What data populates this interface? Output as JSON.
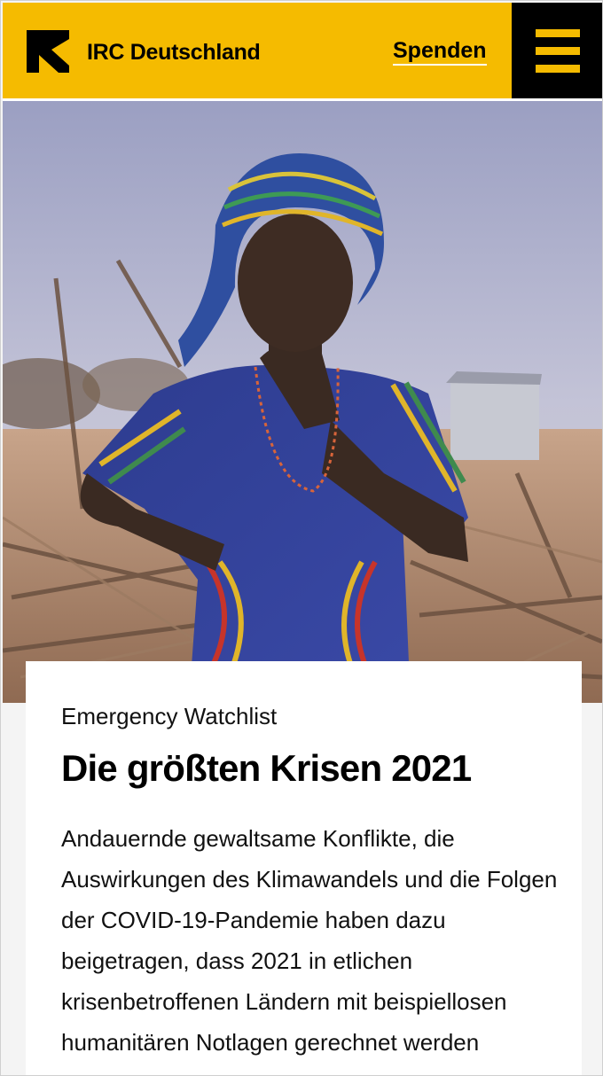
{
  "header": {
    "brand": "IRC Deutschland",
    "donate_label": "Spenden",
    "logo_icon": "irc-logo-icon",
    "menu_icon": "hamburger-menu-icon",
    "colors": {
      "brand_yellow": "#f5bb00",
      "menu_bg": "#000000"
    }
  },
  "hero": {
    "image": "photo-girl-in-patterned-dress-and-headscarf"
  },
  "article": {
    "eyebrow": "Emergency Watchlist",
    "title": "Die größten Krisen 2021",
    "teaser": "Andauernde gewaltsame Konflikte, die Auswirkungen des Klimawandels und die Folgen der COVID-19-Pandemie haben dazu beigetragen, dass 2021 in etlichen krisenbetroffenen Ländern mit beispiellosen humanitären Notlagen gerechnet werden"
  }
}
